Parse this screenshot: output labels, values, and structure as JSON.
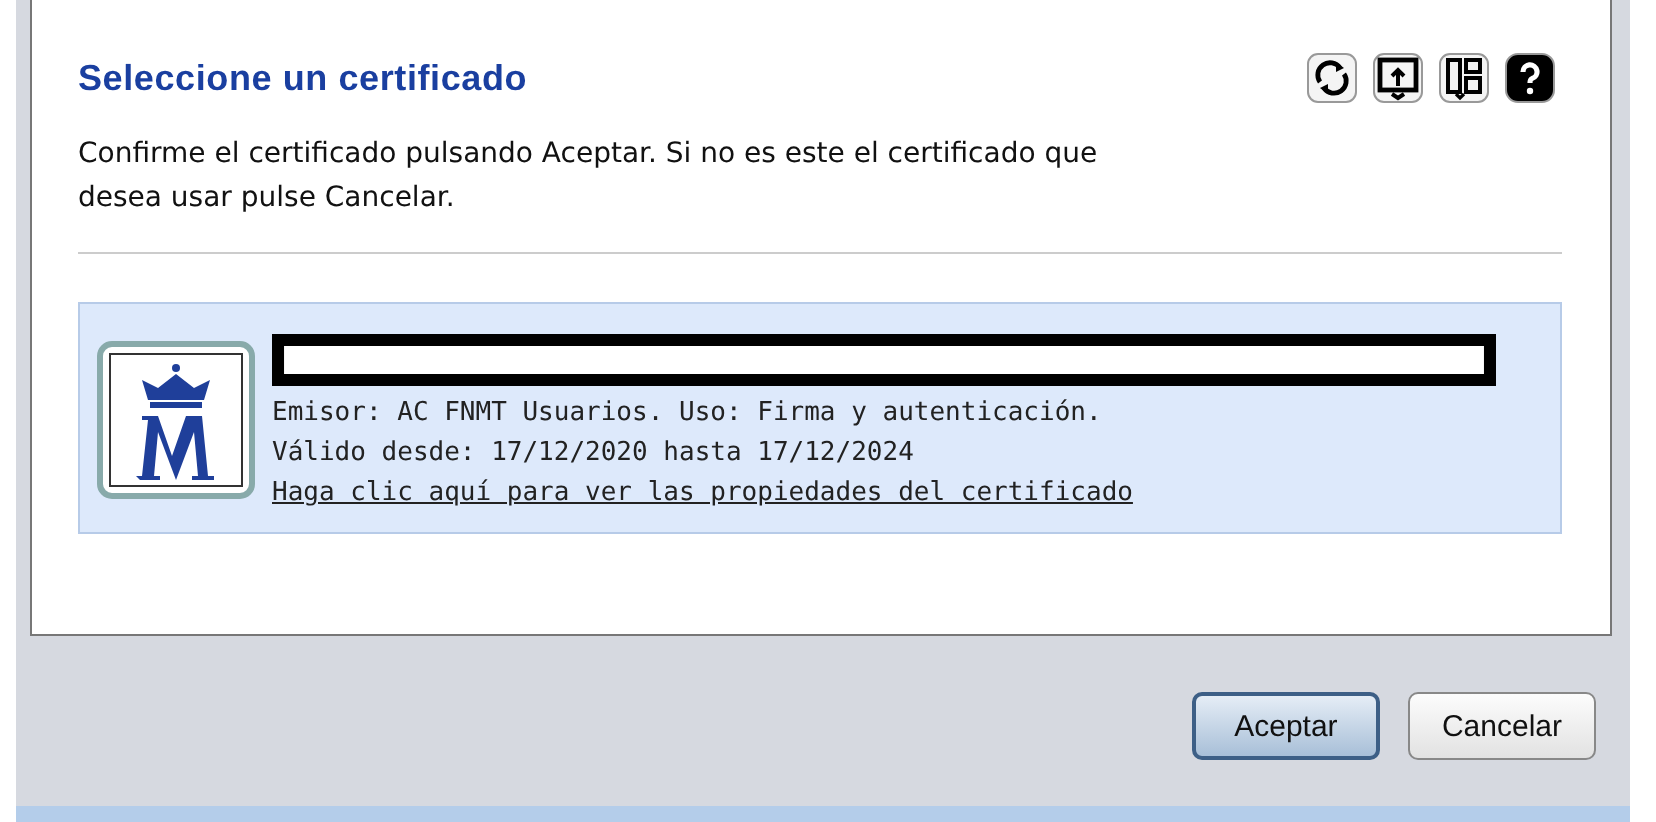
{
  "dialog": {
    "title": "Seleccione un certificado",
    "message": "Confirme el certificado pulsando Aceptar. Si no es este el certificado que desea usar pulse Cancelar."
  },
  "certificate": {
    "selected": true,
    "issuer_line": "Emisor: AC FNMT Usuarios. Uso: Firma y autenticación.",
    "validity_line": "Válido desde: 17/12/2020 hasta 17/12/2024",
    "properties_link": "Haga clic aquí para ver las propiedades del certificado"
  },
  "buttons": [
    {
      "label": "Aceptar",
      "selected": true
    },
    {
      "label": "Cancelar",
      "selected": false
    }
  ]
}
